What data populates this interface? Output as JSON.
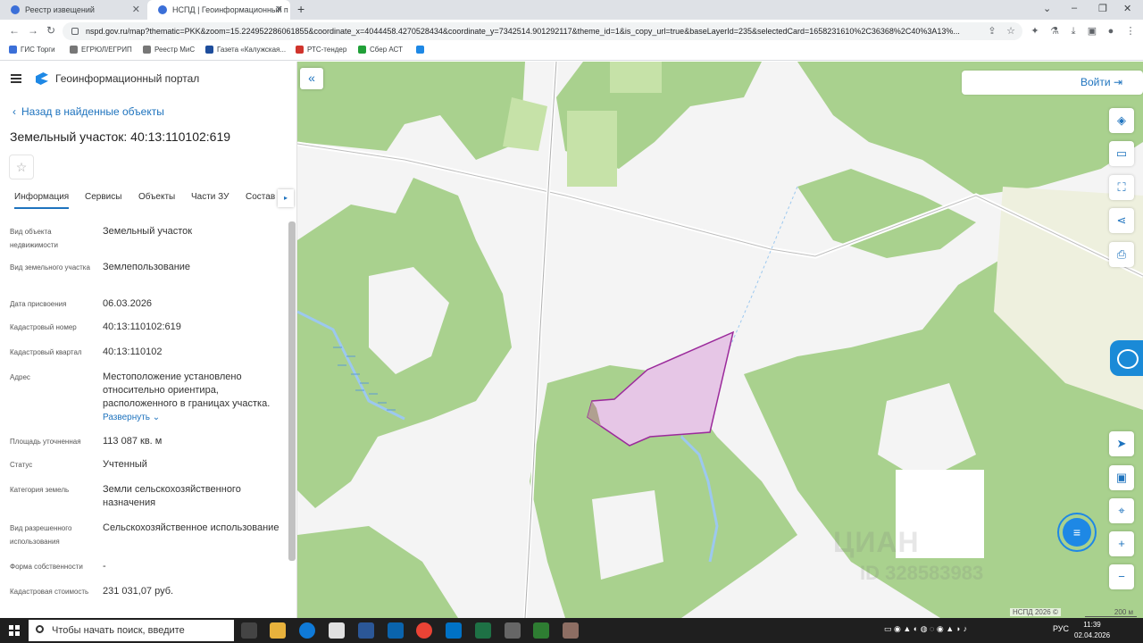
{
  "browser": {
    "tabs": [
      {
        "title": "Реестр извещений"
      },
      {
        "title": "НСПД | Геоинформационный п"
      }
    ],
    "url": "nspd.gov.ru/map?thematic=PKK&zoom=15.224952286061855&coordinate_x=4044458.4270528434&coordinate_y=7342514.901292117&theme_id=1&is_copy_url=true&baseLayerId=235&selectedCard=1658231610%2C36368%2C40%3A13%..."
  },
  "bookmarks": [
    {
      "label": "ГИС Торги",
      "color": "#3b6fd8"
    },
    {
      "label": "ЕГРЮЛ/ЕГРИП",
      "color": "#555555"
    },
    {
      "label": "Реестр МиС",
      "color": "#555555"
    },
    {
      "label": "Газета «Калужская...",
      "color": "#1e4d9c"
    },
    {
      "label": "РТС-тендер",
      "color": "#d0342c"
    },
    {
      "label": "Сбер АСТ",
      "color": "#21a038"
    }
  ],
  "app": {
    "title": "Геоинформационный портал",
    "back_label": "Назад в найденные объекты",
    "object_title": "Земельный участок: 40:13:110102:619",
    "tabs": [
      "Информация",
      "Сервисы",
      "Объекты",
      "Части ЗУ",
      "Состав"
    ],
    "properties": [
      {
        "key": "Вид объекта недвижимости",
        "value": "Земельный участок"
      },
      {
        "key": "Вид земельного участка",
        "value": "Землепользование"
      },
      {
        "key": "Дата присвоения",
        "value": "06.03.2026"
      },
      {
        "key": "Кадастровый номер",
        "value": "40:13:110102:619"
      },
      {
        "key": "Кадастровый квартал",
        "value": "40:13:110102"
      },
      {
        "key": "Адрес",
        "value": "Местоположение установлено относительно ориентира, расположенного в границах участка."
      },
      {
        "key": "Площадь уточненная",
        "value": "113 087 кв. м"
      },
      {
        "key": "Статус",
        "value": "Учтенный"
      },
      {
        "key": "Категория земель",
        "value": "Земли сельскохозяйственного назначения"
      },
      {
        "key": "Вид разрешенного использования",
        "value": "Сельскохозяйственное использование"
      },
      {
        "key": "Форма собственности",
        "value": "-"
      },
      {
        "key": "Кадастровая стоимость",
        "value": "231 031,07 руб."
      }
    ],
    "expand_label": "Развернуть"
  },
  "map": {
    "login_label": "Войти",
    "watermark": "ЦИАН",
    "watermark_id": "ID 328583983",
    "attribution": "НСПД 2026 ©",
    "scale_label": "200 м",
    "colors": {
      "forest": "#a9d18e",
      "field": "#c6e2a8",
      "background": "#f4f4f4",
      "parcel_fill": "#e6c6e6",
      "parcel_stroke": "#9b2a9b",
      "water": "#9cc8ef"
    }
  },
  "taskbar": {
    "search_placeholder": "Чтобы начать поиск, введите",
    "language": "РУС",
    "time": "11:39",
    "date": "02.04.2026"
  }
}
